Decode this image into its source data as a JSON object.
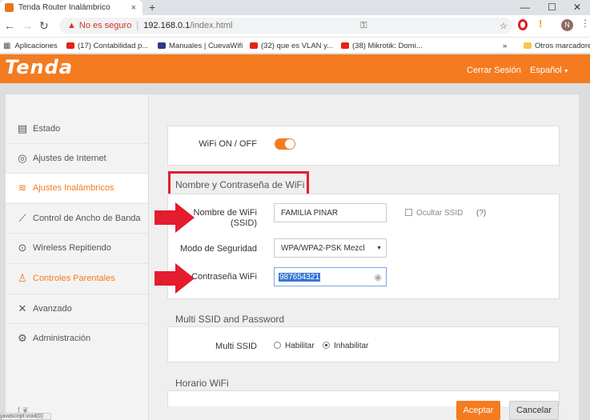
{
  "browser": {
    "tab_title": "Tenda Router Inalámbrico",
    "tab_close": "×",
    "new_tab": "+",
    "win_minimize": "—",
    "win_maximize": "☐",
    "win_close": "✕",
    "security_warning": "No es seguro",
    "url_host": "192.168.0.1",
    "url_path": "/index.html",
    "bookmarks": [
      {
        "label": "Aplicaciones",
        "color": "#555"
      },
      {
        "label": "(17) Contabilidad p...",
        "color": "#e62117"
      },
      {
        "label": "Manuales | CuevaWifi",
        "color": "#2a3a8c"
      },
      {
        "label": "(32) que es VLAN y...",
        "color": "#e62117"
      },
      {
        "label": "(38) Mikrotik: Domi...",
        "color": "#e62117"
      }
    ],
    "bookmarks_more": "»",
    "other_bookmarks": "Otros marcadores"
  },
  "header": {
    "logo": "Tenda",
    "logout": "Cerrar Sesión",
    "language": "Español"
  },
  "sidebar": {
    "items": [
      {
        "label": "Estado",
        "icon": "📊"
      },
      {
        "label": "Ajustes de Internet",
        "icon": "🌐"
      },
      {
        "label": "Ajustes Inalámbricos",
        "icon": "📶"
      },
      {
        "label": "Control de Ancho de Banda",
        "icon": "📈"
      },
      {
        "label": "Wireless Repitiendo",
        "icon": "📡"
      },
      {
        "label": "Controles Parentales",
        "icon": "👪"
      },
      {
        "label": "Avanzado",
        "icon": "🛠"
      },
      {
        "label": "Administración",
        "icon": "⚙"
      }
    ],
    "social": "f  ❦",
    "status_text": "javascript:void(0)"
  },
  "wifi": {
    "onoff_label": "WiFi ON / OFF",
    "section_title": "Nombre y Contraseña de WiFi",
    "ssid_label_1": "Nombre de WiFi",
    "ssid_label_2": "(SSID)",
    "ssid_value": "FAMILIA PINAR",
    "hide_ssid_label": "Ocultar SSID",
    "help_icon_text": "(?)",
    "security_label": "Modo de Seguridad",
    "security_value": "WPA/WPA2-PSK Mezcl",
    "password_label": "Contraseña WiFi",
    "password_value": "987654321"
  },
  "multi_ssid": {
    "section_title": "Multi SSID and Password",
    "label": "Multi SSID",
    "enable": "Habilitar",
    "disable": "Inhabilitar"
  },
  "schedule": {
    "section_title": "Horario WiFi"
  },
  "actions": {
    "accept": "Aceptar",
    "cancel": "Cancelar"
  },
  "colors": {
    "brand": "#f47b20",
    "highlight": "#e41c2e"
  }
}
